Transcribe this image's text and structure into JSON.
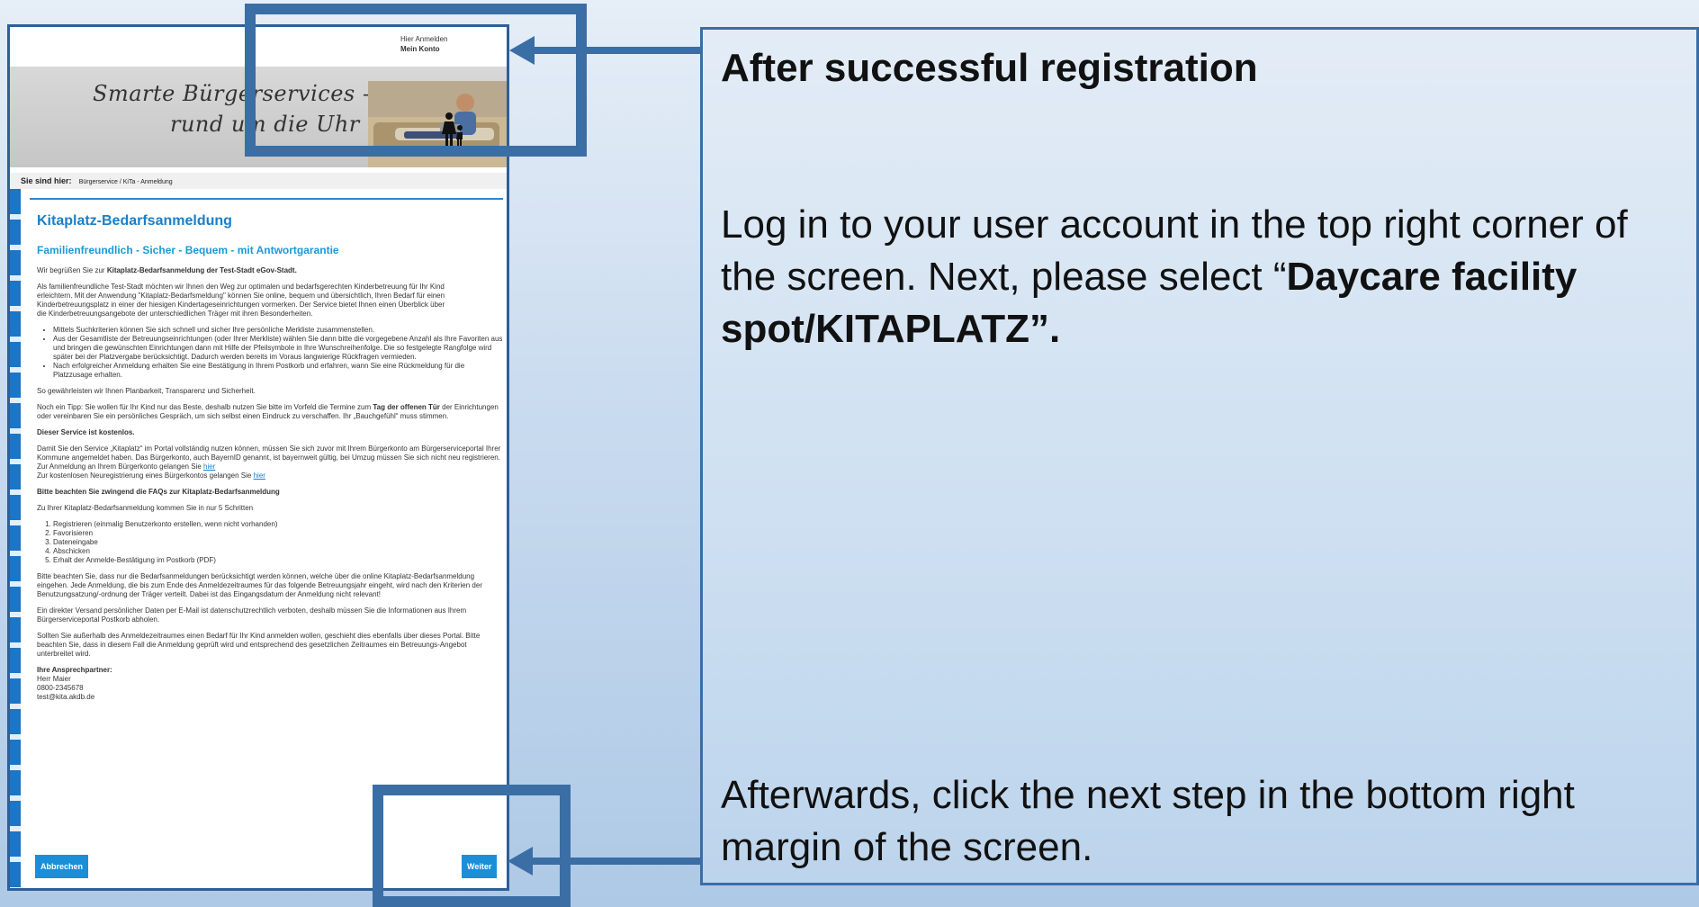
{
  "screenshot": {
    "top_links": {
      "login": "Hier Anmelden",
      "account": "Mein Konto"
    },
    "slogan": {
      "line1": "Smarte Bürgerservices –",
      "line2": "rund um die Uhr"
    },
    "breadcrumb": {
      "label": "Sie sind hier:",
      "path": "Bürgerservice / KiTa - Anmeldung"
    },
    "title": "Kitaplatz-Bedarfsanmeldung",
    "subtitle": "Familienfreundlich - Sicher - Bequem - mit Antwortgarantie",
    "intro": {
      "pre": "Wir begrüßen Sie zur ",
      "bold": "Kitaplatz-Bedarfsanmeldung der Test-Stadt eGov-Stadt."
    },
    "paragraph1": "Als familienfreundliche Test-Stadt möchten wir Ihnen den Weg zur optimalen und bedarfsgerechten Kinderbetreuung für Ihr Kind erleichtern. Mit der Anwendung \"Kitaplatz-Bedarfsmeldung\" können Sie online, bequem und übersichtlich, Ihren Bedarf für einen Kinderbetreuungsplatz in einer der hiesigen Kindertageseinrichtungen vormerken. Der Service bietet Ihnen einen Überblick über die Kinderbetreuungsangebote der unterschiedlichen Träger mit ihren Besonderheiten.",
    "bullets": [
      "Mittels Suchkriterien können Sie sich schnell und sicher Ihre persönliche Merkliste zusammenstellen.",
      "Aus der Gesamtliste der Betreuungseinrichtungen (oder Ihrer Merkliste) wählen Sie dann bitte die vorgegebene Anzahl als Ihre Favoriten aus und bringen die gewünschten Einrichtungen dann mit Hilfe der Pfeilsymbole in Ihre Wunschreihenfolge. Die so festgelegte Rangfolge wird später bei der Platzvergabe berücksichtigt. Dadurch werden bereits im Voraus langwierige Rückfragen vermieden.",
      "Nach erfolgreicher Anmeldung erhalten Sie eine Bestätigung in Ihrem Postkorb und erfahren, wann Sie eine Rückmeldung für die Platzzusage erhalten."
    ],
    "guarantee": "So gewährleisten wir Ihnen Planbarkeit, Transparenz und Sicherheit.",
    "tip": {
      "pre": "Noch ein Tipp: Sie wollen für Ihr Kind nur das Beste, deshalb nutzen Sie bitte im Vorfeld die Termine zum ",
      "bold": "Tag der offenen Tür",
      "post": " der Einrichtungen oder vereinbaren Sie ein persönliches Gespräch, um sich selbst einen Eindruck zu verschaffen. Ihr „Bauchgefühl“ muss stimmen."
    },
    "free_heading": "Dieser Service ist kostenlos.",
    "account_text": "Damit Sie den Service „Kitaplatz“ im Portal vollständig nutzen können, müssen Sie sich zuvor mit Ihrem Bürgerkonto am Bürgerserviceportal Ihrer Kommune angemeldet haben. Das Bürgerkonto, auch BayernID genannt, ist bayernweit gültig, bei Umzug müssen Sie sich nicht neu registrieren.",
    "login_line": "Zur Anmeldung an Ihrem Bürgerkonto gelangen Sie ",
    "register_line": "Zur kostenlosen Neuregistrierung eines Bürgerkontos gelangen Sie ",
    "link_here": "hier",
    "faq_heading": "Bitte beachten Sie zwingend die FAQs zur Kitaplatz-Bedarfsanmeldung",
    "steps_intro": "Zu Ihrer Kitaplatz-Bedarfsanmeldung kommen Sie in nur 5 Schritten",
    "steps": [
      "Registrieren (einmalig Benutzerkonto erstellen, wenn nicht vorhanden)",
      "Favorisieren",
      "Dateneingabe",
      "Abschicken",
      "Erhalt der Anmelde-Bestätigung im Postkorb (PDF)"
    ],
    "note1": "Bitte beachten Sie, dass nur die Bedarfsanmeldungen berücksichtigt werden können, welche über die online Kitaplatz-Bedarfsanmeldung eingehen. Jede Anmeldung, die bis zum Ende des Anmeldezeitraumes für das folgende Betreuungsjahr eingeht, wird nach den Kriterien der Benutzungsatzung/-ordnung der Träger verteilt. Dabei ist das Eingangsdatum der Anmeldung nicht relevant!",
    "note2": "Ein direkter Versand persönlicher Daten per E-Mail ist datenschutzrechtlich verboten, deshalb müssen Sie die Informationen aus Ihrem Bürgerserviceportal Postkorb abholen.",
    "note3": "Sollten Sie außerhalb des Anmeldezeitraumes einen Bedarf für Ihr Kind anmelden wollen, geschieht dies ebenfalls über dieses Portal. Bitte beachten Sie, dass in diesem Fall die Anmeldung geprüft wird und entsprechend des gesetzlichen Zeitraumes ein Betreuungs-Angebot unterbreitet wird.",
    "contact": {
      "heading": "Ihre Ansprechpartner:",
      "name": "Herr Maier",
      "phone": "0800-2345678",
      "email": "test@kita.akdb.de"
    },
    "buttons": {
      "cancel": "Abbrechen",
      "next": "Weiter"
    }
  },
  "instructions": {
    "heading": "After successful registration",
    "step_pre": "Log in to your user account in the top right corner of the screen. Next, please select “",
    "step_bold": "Daycare facility spot/KITAPLATZ”.",
    "next_step": "Afterwards, click the next step in the bottom right margin of the screen."
  },
  "colors": {
    "accent": "#3a6ea5",
    "link": "#1a7fc7",
    "button": "#1a8fd8"
  }
}
